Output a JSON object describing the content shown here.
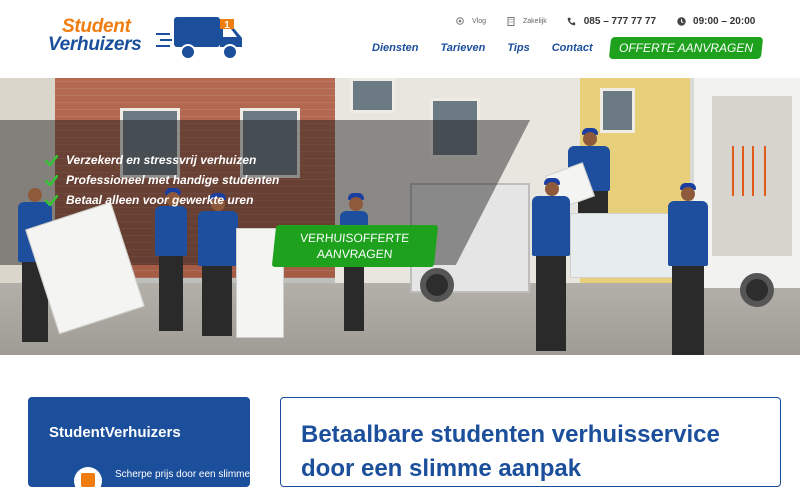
{
  "logo": {
    "line1": "Student",
    "line2": "Verhuizers",
    "badge": "1"
  },
  "topbar": {
    "vlog": {
      "icon": "target-icon",
      "label": "Vlog"
    },
    "zakelijk": {
      "icon": "building-icon",
      "label": "Zakelijk"
    },
    "phone": {
      "icon": "phone-icon",
      "label": "085 – 777 77 77"
    },
    "hours": {
      "icon": "clock-icon",
      "label": "09:00 – 20:00"
    }
  },
  "nav": {
    "items": [
      "Diensten",
      "Tarieven",
      "Tips",
      "Contact"
    ],
    "cta": "OFFERTE AANVRAGEN"
  },
  "hero": {
    "features": [
      "Verzekerd en stressvrij verhuizen",
      "Professioneel met handige studenten",
      "Betaal alleen voor gewerkte uren"
    ],
    "cta_line1": "VERHUISOFFERTE",
    "cta_line2": "AANVRAGEN"
  },
  "sidebar_card": {
    "title": "StudentVerhuizers",
    "item_text": "Scherpe prijs door een slimme"
  },
  "main_card": {
    "title": "Betaalbare studenten verhuisservice door een slimme aanpak"
  },
  "colors": {
    "brand_blue": "#1b4f9c",
    "brand_orange": "#ef7d0f",
    "cta_green": "#1ea21e"
  }
}
